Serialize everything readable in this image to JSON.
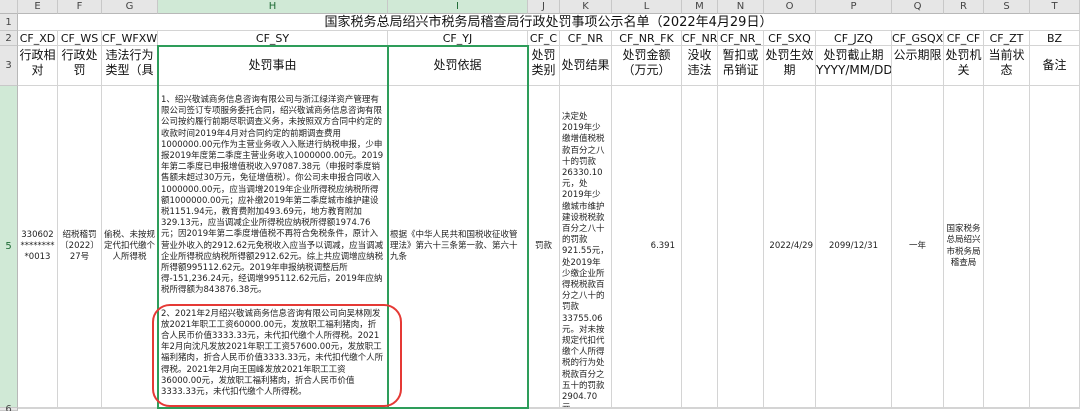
{
  "columns": [
    "E",
    "F",
    "G",
    "H",
    "I",
    "J",
    "K",
    "L",
    "M",
    "N",
    "O",
    "P",
    "Q",
    "R",
    "S",
    "T"
  ],
  "row_numbers": {
    "title": "1",
    "codes": "2",
    "headers": "3",
    "data": "5",
    "after": "6"
  },
  "title": "国家税务总局绍兴市税务局稽查局行政处罚事项公示名单（2022年4月29日）",
  "codes": [
    "CF_XD",
    "CF_WS",
    "CF_WFXW",
    "CF_SY",
    "CF_YJ",
    "CF_C",
    "CF_NR",
    "CF_NR_FK",
    "CF_NR_",
    "CF_NR_",
    "CF_SXQ",
    "CF_JZQ",
    "CF_GSQX",
    "CF_CF",
    "CF_ZT",
    "BZ"
  ],
  "headers": [
    "行政相对",
    "行政处罚",
    "违法行为类型（具",
    "处罚事由",
    "处罚依据",
    "处罚类别",
    "处罚结果",
    "处罚金额（万元）",
    "没收违法",
    "暂扣或吊销证",
    "处罚生效期",
    "处罚截止期YYYY/MM/DD",
    "公示期限",
    "处罚机关",
    "当前状态",
    "备注"
  ],
  "record": {
    "xd": "330602*********0013",
    "ws": "绍税稽罚〔2022〕27号",
    "wfxw": "偷税、未按规定代扣代缴个人所得税",
    "sy_part1": "1、绍兴敬诚商务信息咨询有限公司与浙江绿洋资产管理有限公司签订专项服务委托合同，绍兴敬诚商务信息咨询有限公司按约履行前期尽职调查义务，未按照双方合同中约定的收款时间2019年4月对合同约定的前期调查费用1000000.00元作为主营业务收入入账进行纳税申报，少申报2019年度第二季度主营业务收入1000000.00元。2019年第二季度已申报增值税收入97087.38元（申报时季度销售额未超过30万元，免征增值税）。你公司未申报合同收入1000000.00元，应当调增2019年企业所得税应纳税所得额1000000.00元；应补缴2019年第二季度城市维护建设税1151.94元，教育费附加493.69元，地方教育附加329.13元，应当调减企业所得税应纳税所得额1974.76元；因2019年第二季度增值税不再符合免税条件，原计入营业外收入的2912.62元免税收入应当予以调减，应当调减企业所得税应纳税所得额2912.62元。综上共应调增应纳税所得额995112.62元。2019年申报纳税调整后所得-151,236.24元，经调增995112.62元后，2019年应纳税所得额为843876.38元。",
    "sy_part2": "2、2021年2月绍兴敬诚商务信息咨询有限公司向吴林刚发放2021年职工工资60000.00元，发放职工福利猪肉，折合人民币价值3333.33元，未代扣代缴个人所得税。2021年2月向沈凡发放2021年职工工资57600.00元，发放职工福利猪肉，折合人民币价值3333.33元，未代扣代缴个人所得税。2021年2月向王国峰发放2021年职工工资36000.00元，发放职工福利猪肉，折合人民币价值3333.33元，未代扣代缴个人所得税。",
    "yj": "根据《中华人民共和国税收征收管理法》第六十三条第一款、第六十九条",
    "c": "罚款",
    "nr": "决定处2019年少缴增值税税款百分之八十的罚款26330.10元，处2019年少缴城市维护建设税税款百分之八十的罚款921.55元，处2019年少缴企业所得税税款百分之八十的罚款33755.06元。对未按规定代扣代缴个人所得税的行为处税款百分之五十的罚款2904.70元。",
    "fk": "6.391",
    "ms": "",
    "zk": "",
    "sxq": "2022/4/29",
    "jzq": "2099/12/31",
    "gsqx": "一年",
    "cf": "国家税务总局绍兴市税务局稽查局",
    "zt": "",
    "bz": ""
  }
}
